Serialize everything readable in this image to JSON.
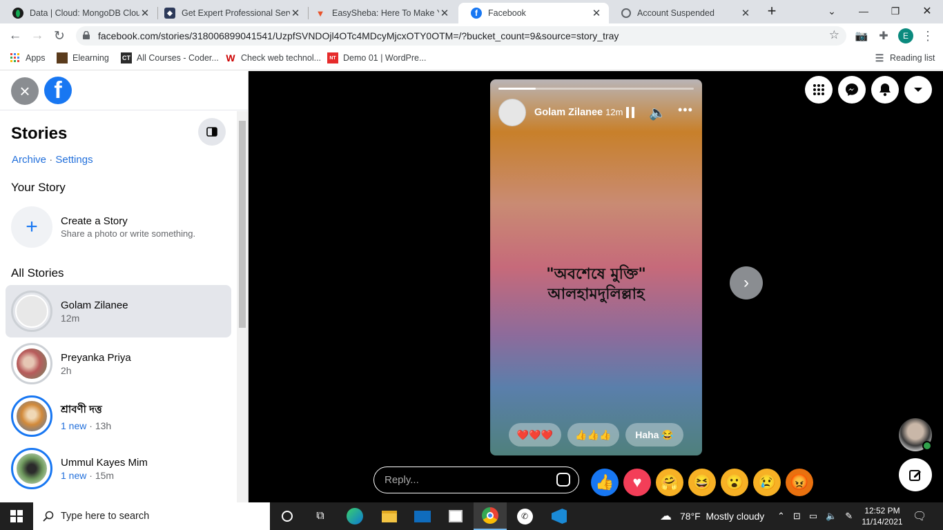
{
  "browser": {
    "tabs": [
      {
        "title": "Data | Cloud: MongoDB Clou",
        "icon": "mongodb-leaf-icon",
        "color": "#00684a"
      },
      {
        "title": "Get Expert Professional Servi",
        "icon": "shield-icon",
        "color": "#2d3a5a"
      },
      {
        "title": "EasySheba: Here To Make You",
        "icon": "easysheba-icon",
        "color": "#e8532b"
      },
      {
        "title": "Facebook",
        "icon": "facebook-icon",
        "color": "#1877f2"
      },
      {
        "title": "Account Suspended",
        "icon": "globe-icon",
        "color": "#5f6368"
      }
    ],
    "url": "facebook.com/stories/318006899041541/UzpfSVNDOjl4OTc4MDcyMjcxOTY0OTM=/?bucket_count=9&source=story_tray",
    "profile_initial": "E",
    "bookmarks": [
      {
        "label": "Apps",
        "color": "#4285f4"
      },
      {
        "label": "Elearning",
        "color": "#5a3b1c"
      },
      {
        "label": "All Courses - Coder...",
        "color": "#2b2b2b",
        "badge": "CT"
      },
      {
        "label": "Check web technol...",
        "color": "#cc0000",
        "badge": "W"
      },
      {
        "label": "Demo 01 | WordPre...",
        "color": "#e62b2b",
        "badge": "NT"
      }
    ],
    "reading_list": "Reading list"
  },
  "sidebar": {
    "title": "Stories",
    "archive": "Archive",
    "separator": "·",
    "settings": "Settings",
    "your_story": "Your Story",
    "create_title": "Create a Story",
    "create_sub": "Share a photo or write something.",
    "all_stories": "All Stories",
    "stories": [
      {
        "name": "Golam Zilanee",
        "time": "12m",
        "new": "",
        "selected": true,
        "seen": true,
        "color": "#d9d9d9"
      },
      {
        "name": "Preyanka Priya",
        "time": "2h",
        "new": "",
        "selected": false,
        "seen": true,
        "color": "#b85b5b"
      },
      {
        "name": "শ্রাবণী দত্ত",
        "time": "13h",
        "new": "1 new",
        "selected": false,
        "seen": false,
        "color": "#d28a3a"
      },
      {
        "name": "Ummul Kayes Mim",
        "time": "15m",
        "new": "1 new",
        "selected": false,
        "seen": false,
        "color": "#6f9a5e"
      }
    ],
    "sep_dot": " · "
  },
  "viewer": {
    "author": "Golam Zilanee",
    "time": "12m",
    "progress": 0.19,
    "line1": "\"অবশেষে মুক্তি\"",
    "line2": "আলহামদুলিল্লাহ",
    "quick_replies": [
      "❤️❤️❤️",
      "👍👍👍",
      "Haha 😂"
    ],
    "reply_placeholder": "Reply...",
    "reactions": [
      {
        "name": "like",
        "glyph": "👍",
        "bg": "#1877f2"
      },
      {
        "name": "love",
        "glyph": "♥",
        "bg": "#f33e58"
      },
      {
        "name": "care",
        "glyph": "🤗",
        "bg": "#f7b125"
      },
      {
        "name": "haha",
        "glyph": "😆",
        "bg": "#f7b125"
      },
      {
        "name": "wow",
        "glyph": "😮",
        "bg": "#f7b125"
      },
      {
        "name": "sad",
        "glyph": "😢",
        "bg": "#f7b125"
      },
      {
        "name": "angry",
        "glyph": "😡",
        "bg": "#e9710f"
      }
    ]
  },
  "taskbar": {
    "search_placeholder": "Type here to search",
    "weather": "78°F  Mostly cloudy",
    "time": "12:52 PM",
    "date": "11/14/2021"
  }
}
